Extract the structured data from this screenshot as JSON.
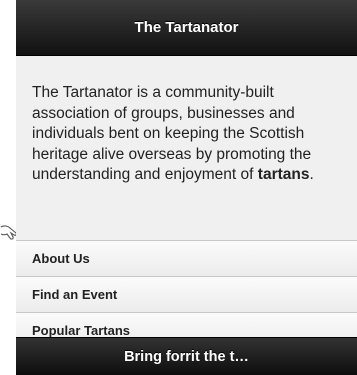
{
  "header": {
    "title": "The Tartanator"
  },
  "intro": {
    "text": "The Tartanator is a community-built association of groups, businesses and individuals bent on keeping the Scottish heritage alive overseas by promoting the understanding and enjoyment of ",
    "emphasis": "tartans",
    "end": "."
  },
  "menu": {
    "items": [
      {
        "label": "About Us"
      },
      {
        "label": "Find an Event"
      },
      {
        "label": "Popular Tartans"
      }
    ]
  },
  "footer": {
    "text": "Bring forrit the t…"
  },
  "icons": {
    "pointer": "hand-pointer-icon"
  },
  "colors": {
    "bar_dark": "#111111",
    "content_bg": "#f0f0f0",
    "menu_border": "#c8c8c8"
  }
}
